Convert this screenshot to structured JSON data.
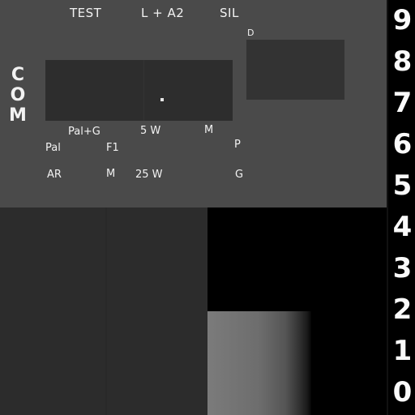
{
  "top_labels": {
    "test": "TEST",
    "l_a2": "L + A2",
    "sil": "SIL"
  },
  "side_label": [
    "C",
    "O",
    "M"
  ],
  "d_label": "D",
  "row1": {
    "pal_g": "Pal+G",
    "w5": "5 W",
    "m": "M"
  },
  "row2": {
    "pal": "Pal",
    "f1": "F1",
    "p": "P"
  },
  "row3": {
    "ar": "AR",
    "m": "M",
    "w25": "25 W",
    "g": "G"
  },
  "digits": [
    "9",
    "8",
    "7",
    "6",
    "5",
    "4",
    "3",
    "2",
    "1",
    "0"
  ]
}
